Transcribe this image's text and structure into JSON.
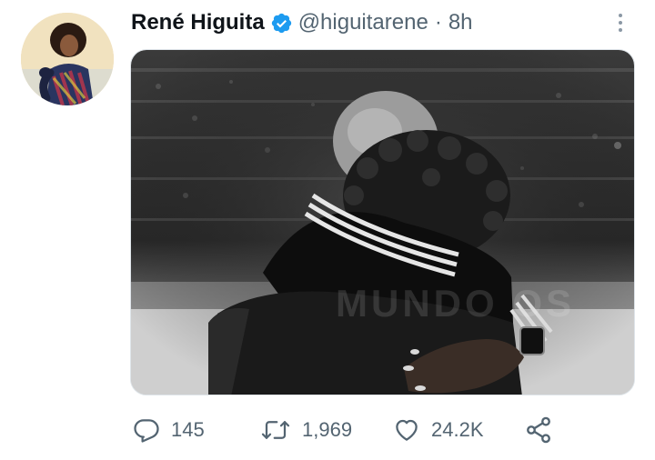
{
  "tweet": {
    "author_name": "René Higuita",
    "handle": "@higuitarene",
    "separator": "·",
    "time_ago": "8h",
    "image_watermark": "MUNDO OS"
  },
  "actions": {
    "reply_count": "145",
    "retweet_count": "1,969",
    "like_count": "24.2K"
  },
  "icons": {
    "verified": "verified-badge-icon",
    "more": "more-options-icon",
    "reply": "reply-icon",
    "retweet": "retweet-icon",
    "like": "heart-icon",
    "share": "share-icon"
  },
  "colors": {
    "verified_blue": "#1d9bf0",
    "secondary_text": "#536471",
    "primary_text": "#0f1419"
  }
}
